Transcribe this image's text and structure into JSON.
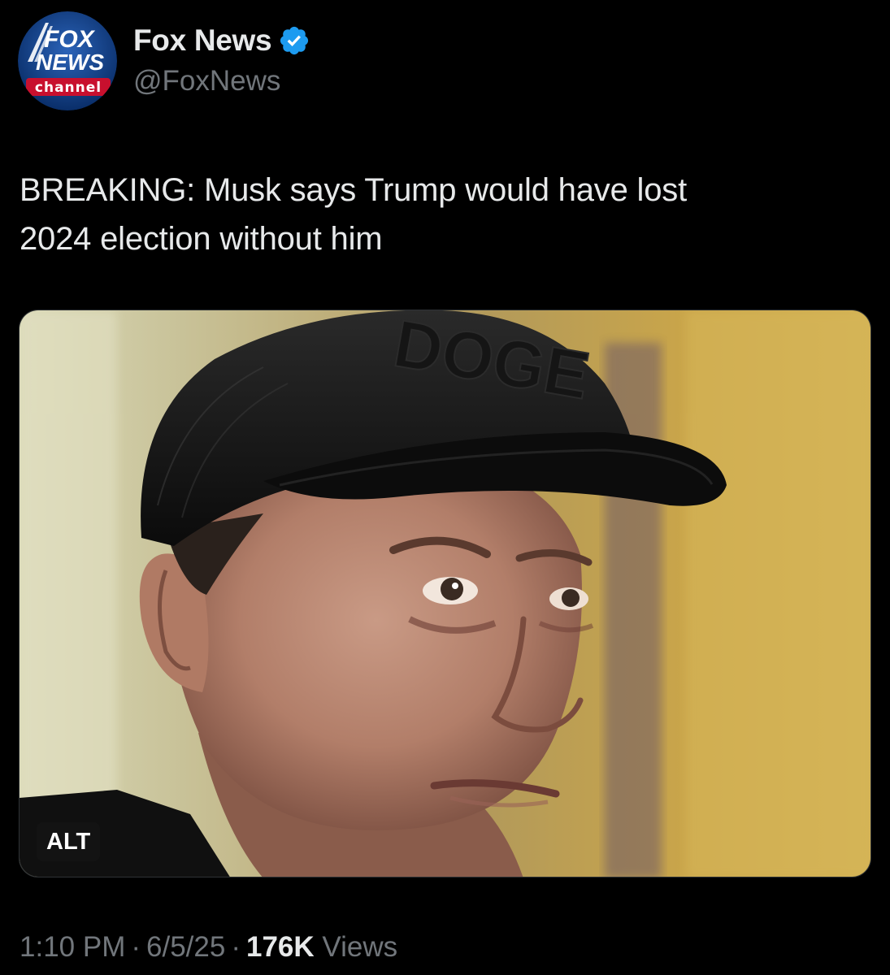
{
  "author": {
    "display_name": "Fox News",
    "handle": "@FoxNews",
    "verified": true,
    "avatar": {
      "logo_top": "FOX",
      "logo_middle": "NEWS",
      "logo_bottom": "channel"
    }
  },
  "tweet": {
    "text": "BREAKING: Musk says Trump would have lost\n2024 election without him"
  },
  "media": {
    "type": "photo",
    "alt_badge": "ALT",
    "cap_lettering": "DOGE"
  },
  "meta": {
    "time": "1:10 PM",
    "separator": "·",
    "date": "6/5/25",
    "views_count": "176K",
    "views_label": "Views"
  },
  "colors": {
    "background": "#000000",
    "text_primary": "#e7e9ea",
    "text_secondary": "#71767b",
    "verified_blue": "#1d9bf0",
    "fox_blue": "#0a3a7c",
    "fox_red": "#c8102e"
  }
}
